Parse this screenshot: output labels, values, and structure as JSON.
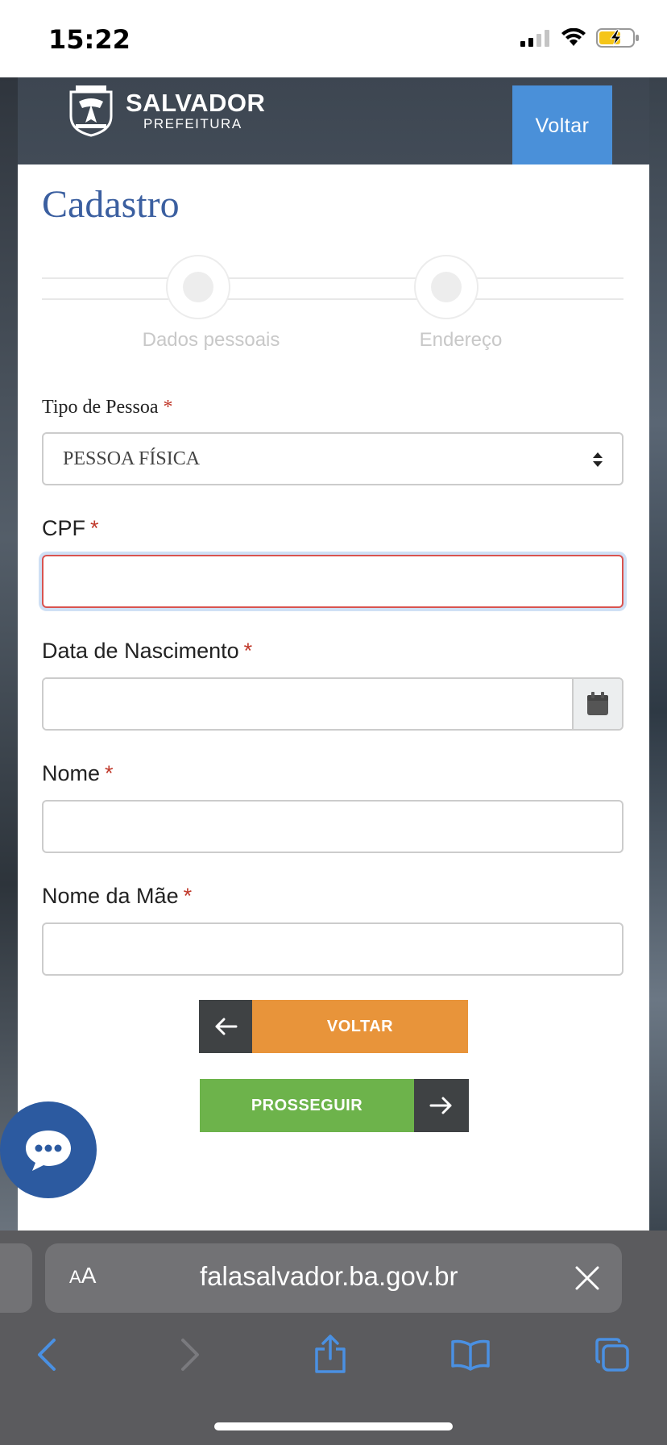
{
  "status_bar": {
    "time": "15:22"
  },
  "header": {
    "logo_title": "SALVADOR",
    "logo_subtitle": "PREFEITURA",
    "back_button": "Voltar"
  },
  "form": {
    "title": "Cadastro",
    "steps": [
      {
        "label": "Dados pessoais"
      },
      {
        "label": "Endereço"
      }
    ],
    "person_type": {
      "label": "Tipo de Pessoa",
      "required": "*",
      "value": "PESSOA FÍSICA"
    },
    "cpf": {
      "label": "CPF",
      "required": "*",
      "value": ""
    },
    "birth_date": {
      "label": "Data de Nascimento",
      "required": "*",
      "value": ""
    },
    "name": {
      "label": "Nome",
      "required": "*",
      "value": ""
    },
    "mother_name": {
      "label": "Nome da Mãe",
      "required": "*",
      "value": ""
    },
    "back_label": "VOLTAR",
    "next_label": "PROSSEGUIR"
  },
  "browser": {
    "text_size_small": "A",
    "text_size_large": "A",
    "url": "falasalvador.ba.gov.br"
  },
  "colors": {
    "title_blue": "#3b5fa0",
    "voltar_blue": "#4a90d9",
    "back_orange": "#e8943a",
    "next_green": "#6db34b",
    "required_red": "#c0392b",
    "chat_blue": "#2c5aa0"
  }
}
